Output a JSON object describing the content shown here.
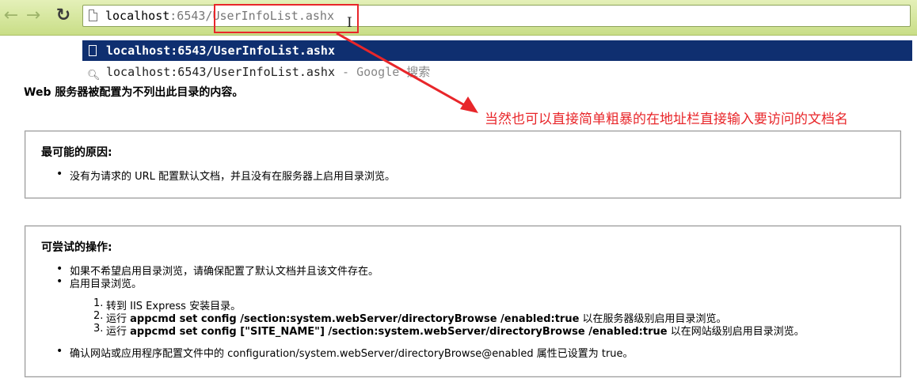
{
  "toolbar": {
    "back_icon": "left-arrow-icon",
    "forward_icon": "right-arrow-icon",
    "reload_icon": "reload-icon",
    "url_host": "localhost",
    "url_port": ":6543/",
    "url_path": "UserInfoList.ashx"
  },
  "suggestions": [
    {
      "text": "localhost:6543/UserInfoList.ashx",
      "suffix": "",
      "icon": "page-icon"
    },
    {
      "text": "localhost:6543/UserInfoList.ashx",
      "suffix": " - Google 搜索",
      "icon": "search-icon"
    }
  ],
  "content": {
    "heading": "Web 服务器被配置为不列出此目录的内容。",
    "annotation": "当然也可以直接简单粗暴的在地址栏直接输入要访问的文档名",
    "box1": {
      "title": "最可能的原因:",
      "items": [
        "没有为请求的 URL 配置默认文档，并且没有在服务器上启用目录浏览。"
      ]
    },
    "box2": {
      "title": "可尝试的操作:",
      "items": [
        "如果不希望启用目录浏览，请确保配置了默认文档并且该文件存在。",
        "启用目录浏览。"
      ],
      "steps": [
        {
          "num": "1.",
          "pre": "转到 IIS Express 安装目录。",
          "cmd": "",
          "post": ""
        },
        {
          "num": "2.",
          "pre": "运行 ",
          "cmd": "appcmd set config /section:system.webServer/directoryBrowse /enabled:true",
          "post": " 以在服务器级别启用目录浏览。"
        },
        {
          "num": "3.",
          "pre": "运行 ",
          "cmd": "appcmd set config [\"SITE_NAME\"] /section:system.webServer/directoryBrowse /enabled:true",
          "post": " 以在网站级别启用目录浏览。"
        }
      ],
      "last_item": "确认网站或应用程序配置文件中的 configuration/system.webServer/directoryBrowse@enabled 属性已设置为 true。"
    }
  },
  "colors": {
    "annotation_red": "#e8262a",
    "selection_blue": "#0f2f70",
    "toolbar_green": "#c9de87"
  }
}
